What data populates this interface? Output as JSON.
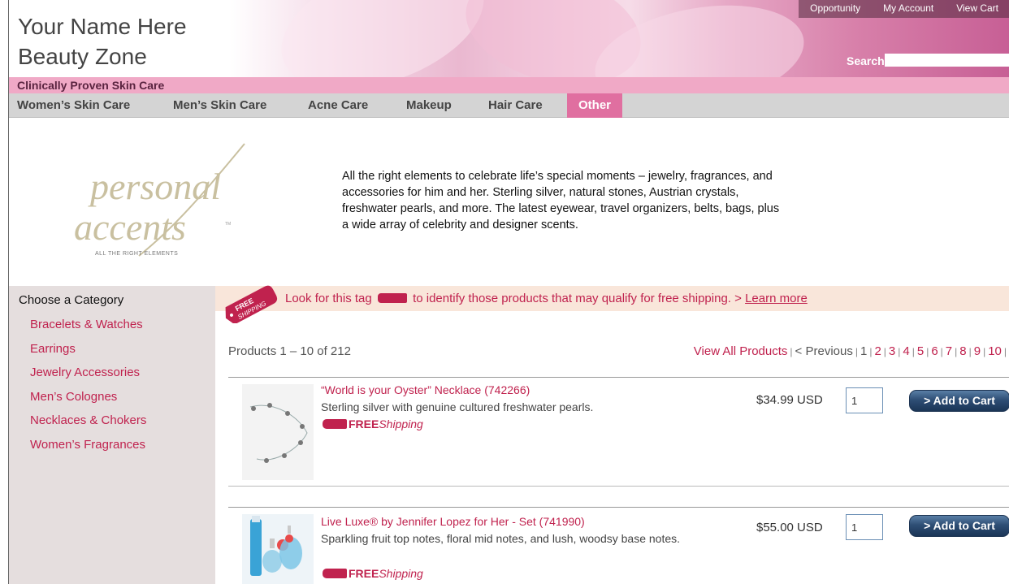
{
  "header": {
    "brand_line1": "Your Name Here",
    "brand_line2": "Beauty Zone",
    "topnav": [
      "Opportunity",
      "My Account",
      "View Cart"
    ],
    "search_label": "Search",
    "search_value": ""
  },
  "tagline": "Clinically Proven Skin Care",
  "catnav": {
    "items": [
      "Women’s Skin Care",
      "Men’s Skin Care",
      "Acne Care",
      "Makeup",
      "Hair Care",
      "Other"
    ],
    "active": "Other"
  },
  "banner": {
    "logo_text1": "personal",
    "logo_text2": "accents",
    "logo_tm": "TM",
    "logo_sub": "ALL THE RIGHT ELEMENTS",
    "intro_text": "All the right elements to celebrate life’s special moments – jewelry, fragrances, and accessories for him and her. Sterling silver, natural stones, Austrian crystals, freshwater pearls, and more. The latest eyewear, travel organizers, belts, bags, plus a wide array of celebrity and designer scents."
  },
  "sidebar": {
    "title": "Choose a Category",
    "items": [
      "Bracelets & Watches",
      "Earrings",
      "Jewelry Accessories",
      "Men’s Colognes",
      "Necklaces & Chokers",
      "Women’s Fragrances"
    ]
  },
  "shipping": {
    "tag_line1": "FREE",
    "tag_line2": "SHIPPING",
    "text_before": "Look for this tag",
    "text_after": "to identify those products that may qualify for free shipping.",
    "learn_prefix": "> ",
    "learn_more": "Learn more"
  },
  "listing": {
    "count_text": "Products 1 – 10 of 212",
    "view_all": "View All Products",
    "previous": "< Previous",
    "current_page": "1",
    "pages": [
      "2",
      "3",
      "4",
      "5",
      "6",
      "7",
      "8",
      "9",
      "10"
    ]
  },
  "products": [
    {
      "title": "“World is your Oyster” Necklace (742266)",
      "description": "Sterling silver with genuine cultured freshwater pearls.",
      "free_bold": "FREE",
      "free_italic": "Shipping",
      "price": "$34.99 USD",
      "qty": "1",
      "button": "> Add to Cart"
    },
    {
      "title": "Live Luxe® by Jennifer Lopez for Her - Set (741990)",
      "description": "Sparkling fruit top notes, floral mid notes, and lush, woodsy base notes.",
      "free_bold": "FREE",
      "free_italic": "Shipping",
      "price": "$55.00 USD",
      "qty": "1",
      "button": "> Add to Cart"
    }
  ],
  "colors": {
    "accent": "#c0224e",
    "pink_bar": "#f0a9c6",
    "active_tab": "#e06fa0",
    "sidebar_bg": "#e5dede",
    "button_blue": "#2e4e75"
  }
}
